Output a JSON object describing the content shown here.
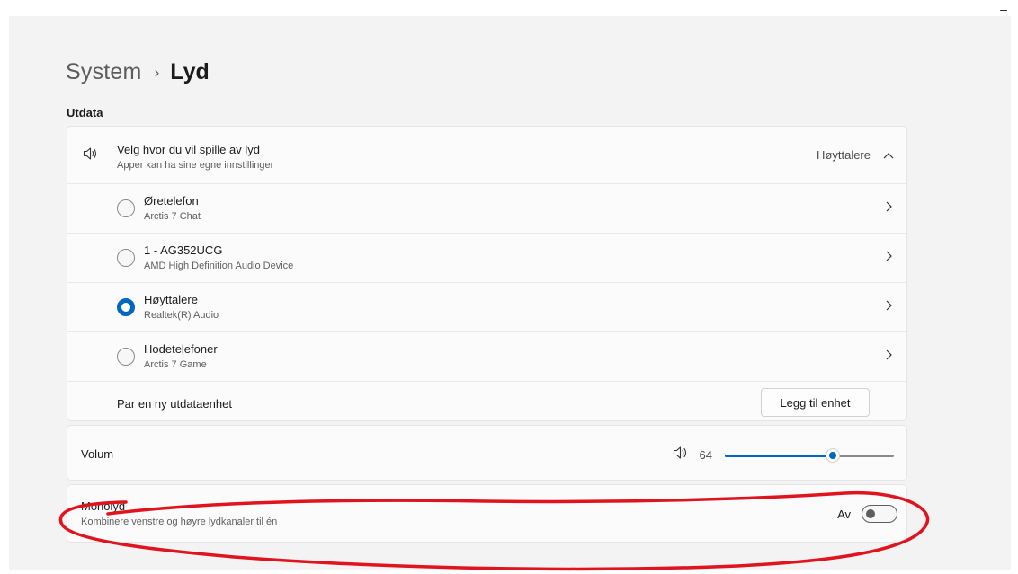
{
  "window": {
    "minimize_glyph": "–"
  },
  "breadcrumb": {
    "parent": "System",
    "separator": "›",
    "current": "Lyd"
  },
  "output": {
    "section_label": "Utdata",
    "header": {
      "icon": "speaker-icon",
      "title": "Velg hvor du vil spille av lyd",
      "subtitle": "Apper kan ha sine egne innstillinger",
      "value": "Høyttalere",
      "expanded": true
    },
    "devices": [
      {
        "name": "Øretelefon",
        "driver": "Arctis 7 Chat",
        "selected": false
      },
      {
        "name": "1 - AG352UCG",
        "driver": "AMD High Definition Audio Device",
        "selected": false
      },
      {
        "name": "Høyttalere",
        "driver": "Realtek(R) Audio",
        "selected": true
      },
      {
        "name": "Hodetelefoner",
        "driver": "Arctis 7 Game",
        "selected": false
      }
    ],
    "pair": {
      "label": "Par en ny utdataenhet",
      "button": "Legg til enhet"
    }
  },
  "volume": {
    "label": "Volum",
    "value": "64",
    "level": 64
  },
  "mono": {
    "title": "Monolyd",
    "subtitle": "Kombinere venstre og høyre lydkanaler til én",
    "state_label": "Av",
    "on": false
  },
  "colors": {
    "accent": "#0067c0",
    "annotation": "#e0141e",
    "background": "#f3f3f3",
    "card": "#fbfbfb"
  }
}
